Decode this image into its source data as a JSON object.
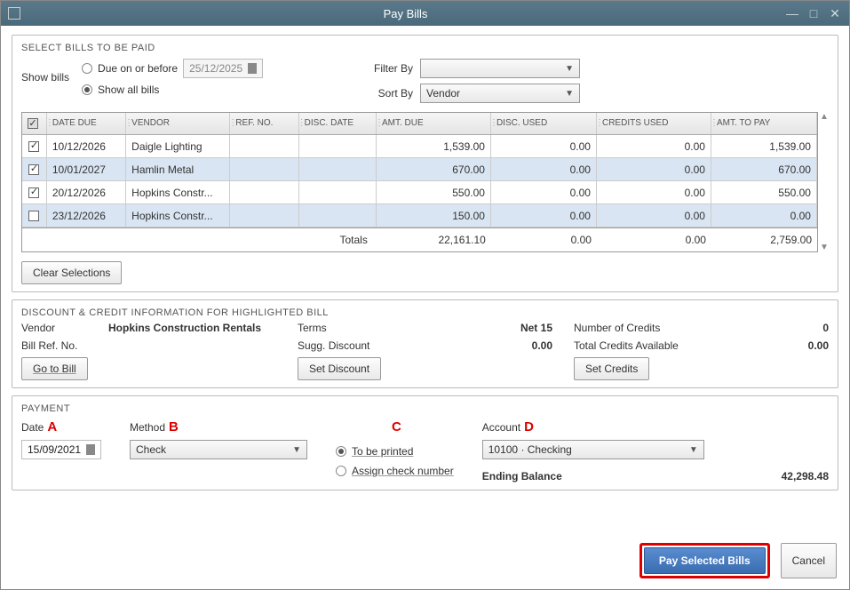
{
  "window": {
    "title": "Pay Bills"
  },
  "selectBills": {
    "title": "SELECT BILLS TO BE PAID",
    "showBillsLabel": "Show bills",
    "dueOnBefore": "Due on or before",
    "dueDate": "25/12/2025",
    "showAll": "Show all bills",
    "filterByLabel": "Filter By",
    "filterByValue": "",
    "sortByLabel": "Sort By",
    "sortByValue": "Vendor"
  },
  "table": {
    "headers": {
      "dateDue": "DATE DUE",
      "vendor": "VENDOR",
      "refNo": "REF. NO.",
      "discDate": "DISC. DATE",
      "amtDue": "AMT. DUE",
      "discUsed": "DISC. USED",
      "creditsUsed": "CREDITS USED",
      "amtToPay": "AMT. TO PAY"
    },
    "rows": [
      {
        "checked": true,
        "date": "10/12/2026",
        "vendor": "Daigle Lighting",
        "ref": "",
        "discDate": "",
        "amt": "1,539.00",
        "discUsed": "0.00",
        "creditsUsed": "0.00",
        "pay": "1,539.00"
      },
      {
        "checked": true,
        "date": "10/01/2027",
        "vendor": "Hamlin Metal",
        "ref": "",
        "discDate": "",
        "amt": "670.00",
        "discUsed": "0.00",
        "creditsUsed": "0.00",
        "pay": "670.00"
      },
      {
        "checked": true,
        "date": "20/12/2026",
        "vendor": "Hopkins Constr...",
        "ref": "",
        "discDate": "",
        "amt": "550.00",
        "discUsed": "0.00",
        "creditsUsed": "0.00",
        "pay": "550.00"
      },
      {
        "checked": false,
        "date": "23/12/2026",
        "vendor": "Hopkins Constr...",
        "ref": "",
        "discDate": "",
        "amt": "150.00",
        "discUsed": "0.00",
        "creditsUsed": "0.00",
        "pay": "0.00"
      }
    ],
    "totalsLabel": "Totals",
    "totals": {
      "amt": "22,161.10",
      "discUsed": "0.00",
      "creditsUsed": "0.00",
      "pay": "2,759.00"
    }
  },
  "clearSelections": "Clear Selections",
  "discInfo": {
    "title": "DISCOUNT & CREDIT INFORMATION FOR HIGHLIGHTED BILL",
    "vendorLabel": "Vendor",
    "vendorValue": "Hopkins Construction Rentals",
    "billRefLabel": "Bill Ref. No.",
    "billRefValue": "",
    "goToBill": "Go to Bill",
    "termsLabel": "Terms",
    "termsValue": "Net 15",
    "suggLabel": "Sugg. Discount",
    "suggValue": "0.00",
    "setDiscount": "Set Discount",
    "numCreditsLabel": "Number of Credits",
    "numCreditsValue": "0",
    "totalCreditsLabel": "Total Credits Available",
    "totalCreditsValue": "0.00",
    "setCredits": "Set Credits"
  },
  "payment": {
    "title": "PAYMENT",
    "dateLabel": "Date",
    "dateValue": "15/09/2021",
    "methodLabel": "Method",
    "methodValue": "Check",
    "toBePrinted": "To be printed",
    "assignCheck": "Assign check number",
    "accountLabel": "Account",
    "accountValue": "10100 · Checking",
    "endingLabel": "Ending Balance",
    "endingValue": "42,298.48",
    "letterA": "A",
    "letterB": "B",
    "letterC": "C",
    "letterD": "D"
  },
  "footer": {
    "paySelected": "Pay Selected Bills",
    "cancel": "Cancel"
  }
}
